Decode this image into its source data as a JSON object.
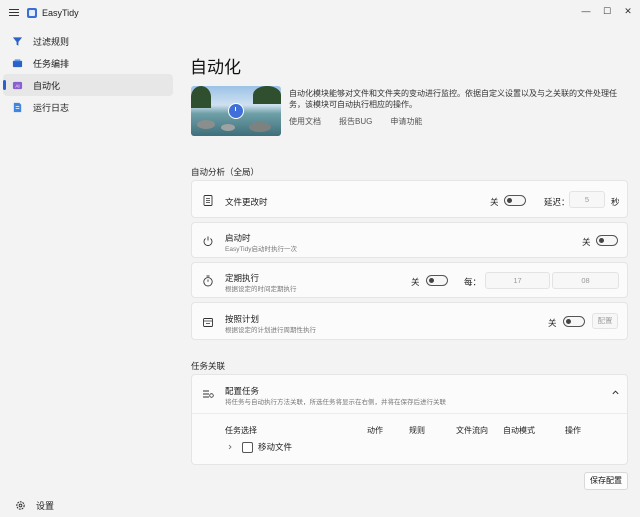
{
  "window": {
    "title": "EasyTidy",
    "min": "—",
    "max": "☐",
    "close": "✕"
  },
  "sidebar": {
    "items": [
      {
        "label": "过滤规则",
        "icon": "filter-icon"
      },
      {
        "label": "任务编排",
        "icon": "task-icon"
      },
      {
        "label": "自动化",
        "icon": "automation-icon"
      },
      {
        "label": "运行日志",
        "icon": "log-icon"
      }
    ],
    "settings_label": "设置"
  },
  "page": {
    "title": "自动化",
    "description": "自动化模块能够对文件和文件夹的变动进行监控。依据自定义设置以及与之关联的文件处理任务，该模块可自动执行相应的操作。",
    "links": [
      "使用文档",
      "报告BUG",
      "申请功能"
    ]
  },
  "auto_section": {
    "title": "自动分析（全局）",
    "file_change": {
      "title": "文件更改时",
      "toggle": "关",
      "delay_label": "延迟：",
      "delay_value": "5",
      "unit": "秒"
    },
    "startup": {
      "title": "启动时",
      "sub": "EasyTidy启动时执行一次",
      "toggle": "关"
    },
    "scheduled": {
      "title": "定期执行",
      "sub": "根据设定的时间定期执行",
      "toggle": "关",
      "every_label": "每：",
      "hour": "17",
      "minute": "08"
    },
    "plan": {
      "title": "按照计划",
      "sub": "根据设定的计划进行周期性执行",
      "toggle": "关",
      "config_label": "配置"
    }
  },
  "task_section": {
    "title": "任务关联",
    "config": {
      "title": "配置任务",
      "sub": "将任务与自动执行方法关联，所选任务将显示在右侧，并将在保存后进行关联"
    },
    "columns": [
      "任务选择",
      "动作",
      "规则",
      "文件流向",
      "自动模式",
      "操作"
    ],
    "rows": [
      {
        "label": "移动文件"
      }
    ]
  },
  "save_label": "保存配置"
}
